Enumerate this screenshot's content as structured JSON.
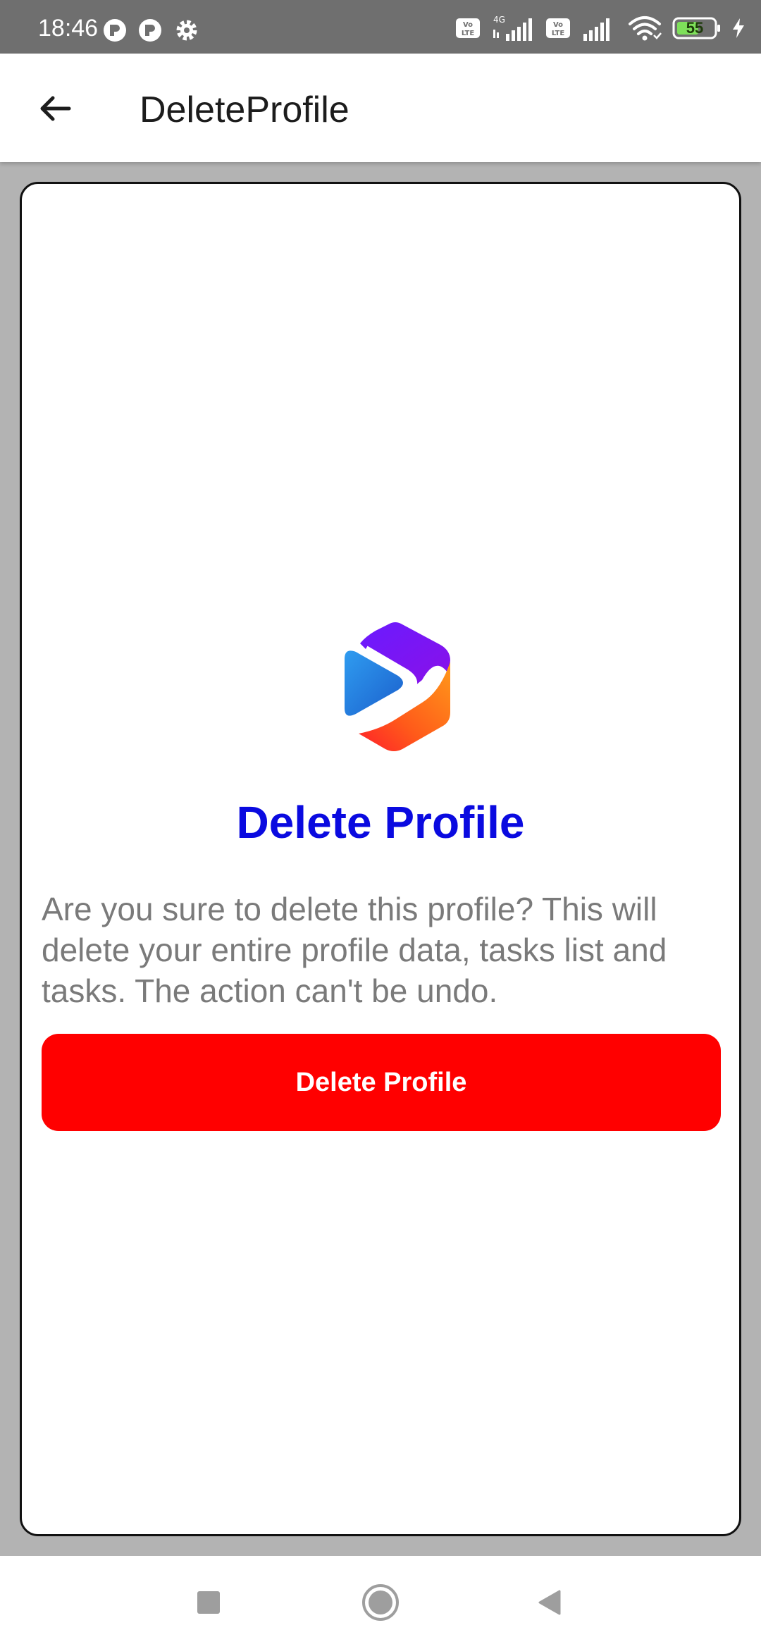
{
  "status_bar": {
    "time": "18:46",
    "battery_level": "55",
    "icons": [
      "notification-app-icon",
      "notification-app-icon",
      "settings-gear-icon",
      "volte-icon",
      "4g-signal-icon",
      "volte-icon",
      "signal-icon",
      "wifi-icon",
      "battery-icon",
      "charging-icon"
    ]
  },
  "app_bar": {
    "title": "DeleteProfile",
    "back_icon": "arrow-back-icon"
  },
  "content": {
    "logo_icon": "app-logo-icon",
    "heading": "Delete Profile",
    "message": "Are you sure to delete this profile? This will delete your entire profile data, tasks list and tasks. The action can't be undo.",
    "button_label": "Delete Profile"
  },
  "colors": {
    "heading": "#0a0ae0",
    "button": "#ff0000",
    "message": "#7a7a7a"
  },
  "nav_bar": {
    "items": [
      "recents-square-icon",
      "home-circle-icon",
      "back-triangle-icon"
    ]
  }
}
